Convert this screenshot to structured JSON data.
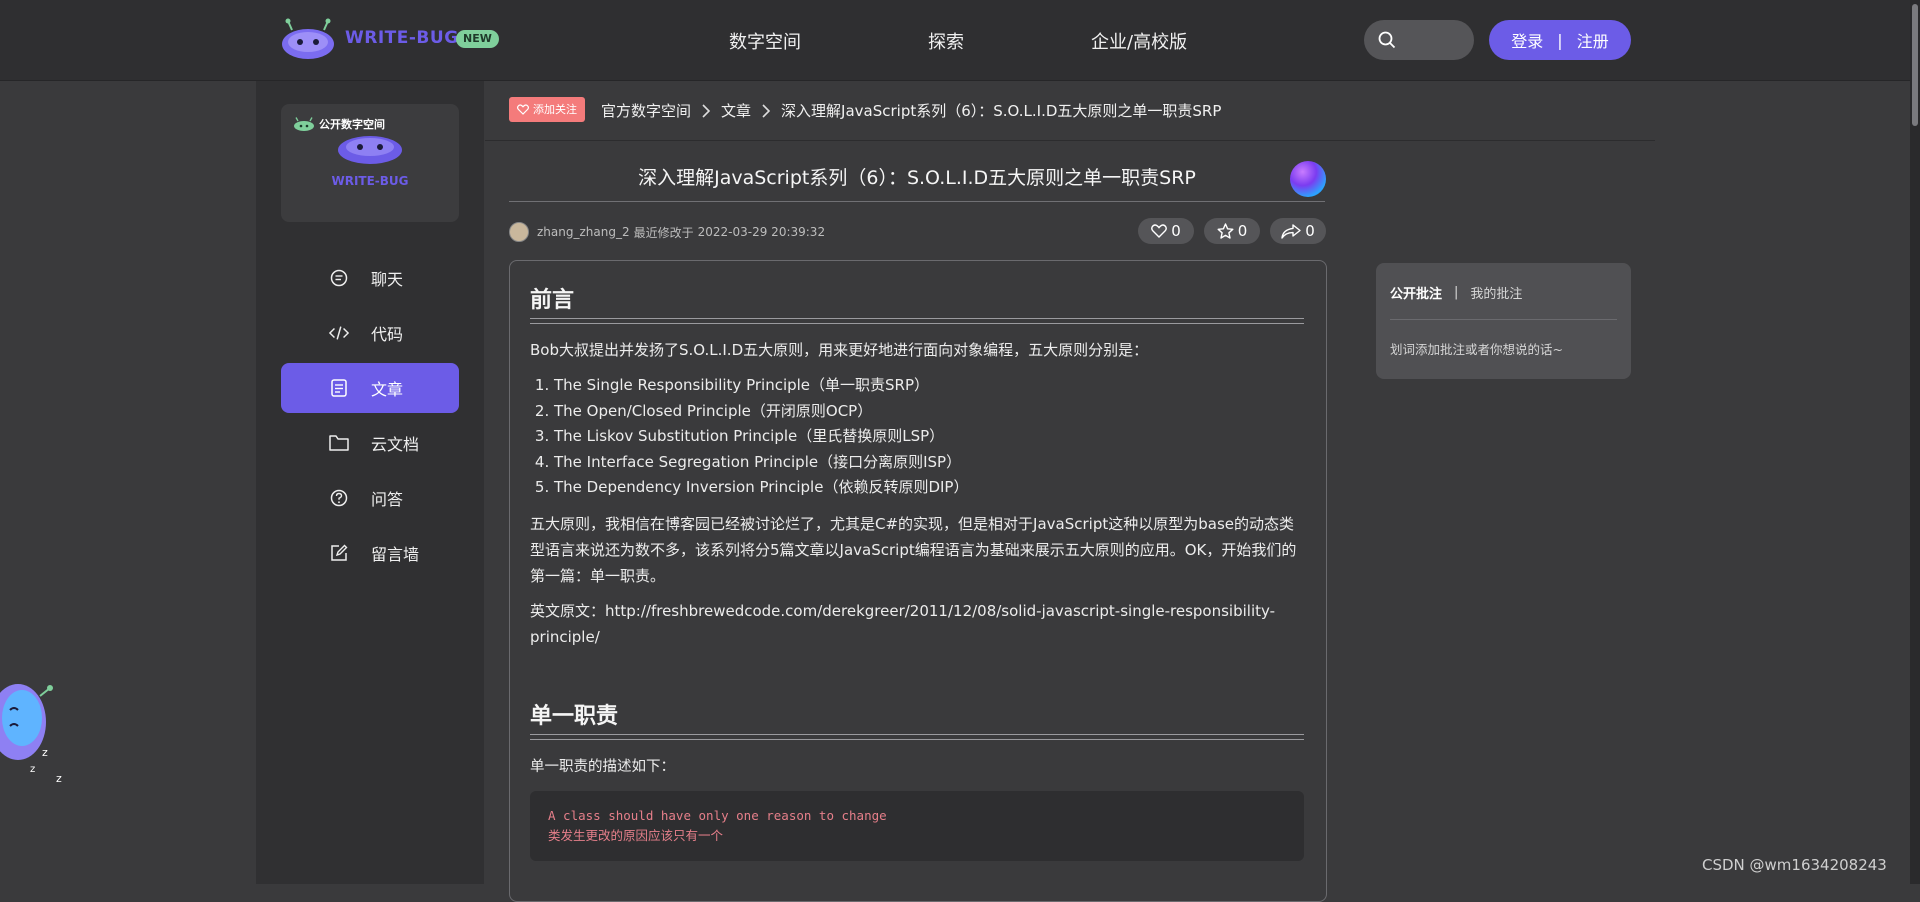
{
  "header": {
    "brand": "WRITE-BUG",
    "badge": "NEW",
    "nav": [
      "数字空间",
      "探索",
      "企业/高校版"
    ],
    "login": "登录",
    "divider": "|",
    "register": "注册"
  },
  "sidebar": {
    "space_tag": "公开数字空间",
    "space_name": "WRITE-BUG",
    "items": [
      {
        "label": "聊天",
        "icon": "chat-icon"
      },
      {
        "label": "代码",
        "icon": "code-icon"
      },
      {
        "label": "文章",
        "icon": "article-icon",
        "active": true
      },
      {
        "label": "云文档",
        "icon": "folder-icon"
      },
      {
        "label": "问答",
        "icon": "question-icon"
      },
      {
        "label": "留言墙",
        "icon": "edit-icon"
      }
    ]
  },
  "breadcrumb": {
    "follow": "添加关注",
    "items": [
      "官方数字空间",
      "文章",
      "深入理解JavaScript系列（6）：S.O.L.I.D五大原则之单一职责SRP"
    ]
  },
  "article": {
    "title": "深入理解JavaScript系列（6）：S.O.L.I.D五大原则之单一职责SRP",
    "author": "zhang_zhang_2",
    "modified_label": "最近修改于",
    "modified": "2022-03-29 20:39:32",
    "likes": "0",
    "stars": "0",
    "shares": "0",
    "h_intro": "前言",
    "intro": "Bob大叔提出并发扬了S.O.L.I.D五大原则，用来更好地进行面向对象编程，五大原则分别是：",
    "principles": [
      "The Single Responsibility Principle（单一职责SRP）",
      "The Open/Closed Principle（开闭原则OCP）",
      "The Liskov Substitution Principle（里氏替换原则LSP）",
      "The Interface Segregation Principle（接口分离原则ISP）",
      "The Dependency Inversion Principle（依赖反转原则DIP）"
    ],
    "para2": "五大原则，我相信在博客园已经被讨论烂了，尤其是C#的实现，但是相对于JavaScript这种以原型为base的动态类型语言来说还为数不多，该系列将分5篇文章以JavaScript编程语言为基础来展示五大原则的应用。OK，开始我们的第一篇：单一职责。",
    "para3": "英文原文：http://freshbrewedcode.com/derekgreer/2011/12/08/solid-javascript-single-responsibility-principle/",
    "h_srp": "单一职责",
    "srp_desc": "单一职责的描述如下：",
    "code_en": "A class should have only one reason to change",
    "code_zh": "类发生更改的原因应该只有一个"
  },
  "annotations": {
    "public": "公开批注",
    "divider": "|",
    "mine": "我的批注",
    "hint": "划词添加批注或者你想说的话~"
  },
  "watermark": "CSDN @wm1634208243",
  "colors": {
    "accent": "#6c5ce7",
    "follow": "#f47b7b",
    "new_badge": "#7fcf9b"
  }
}
